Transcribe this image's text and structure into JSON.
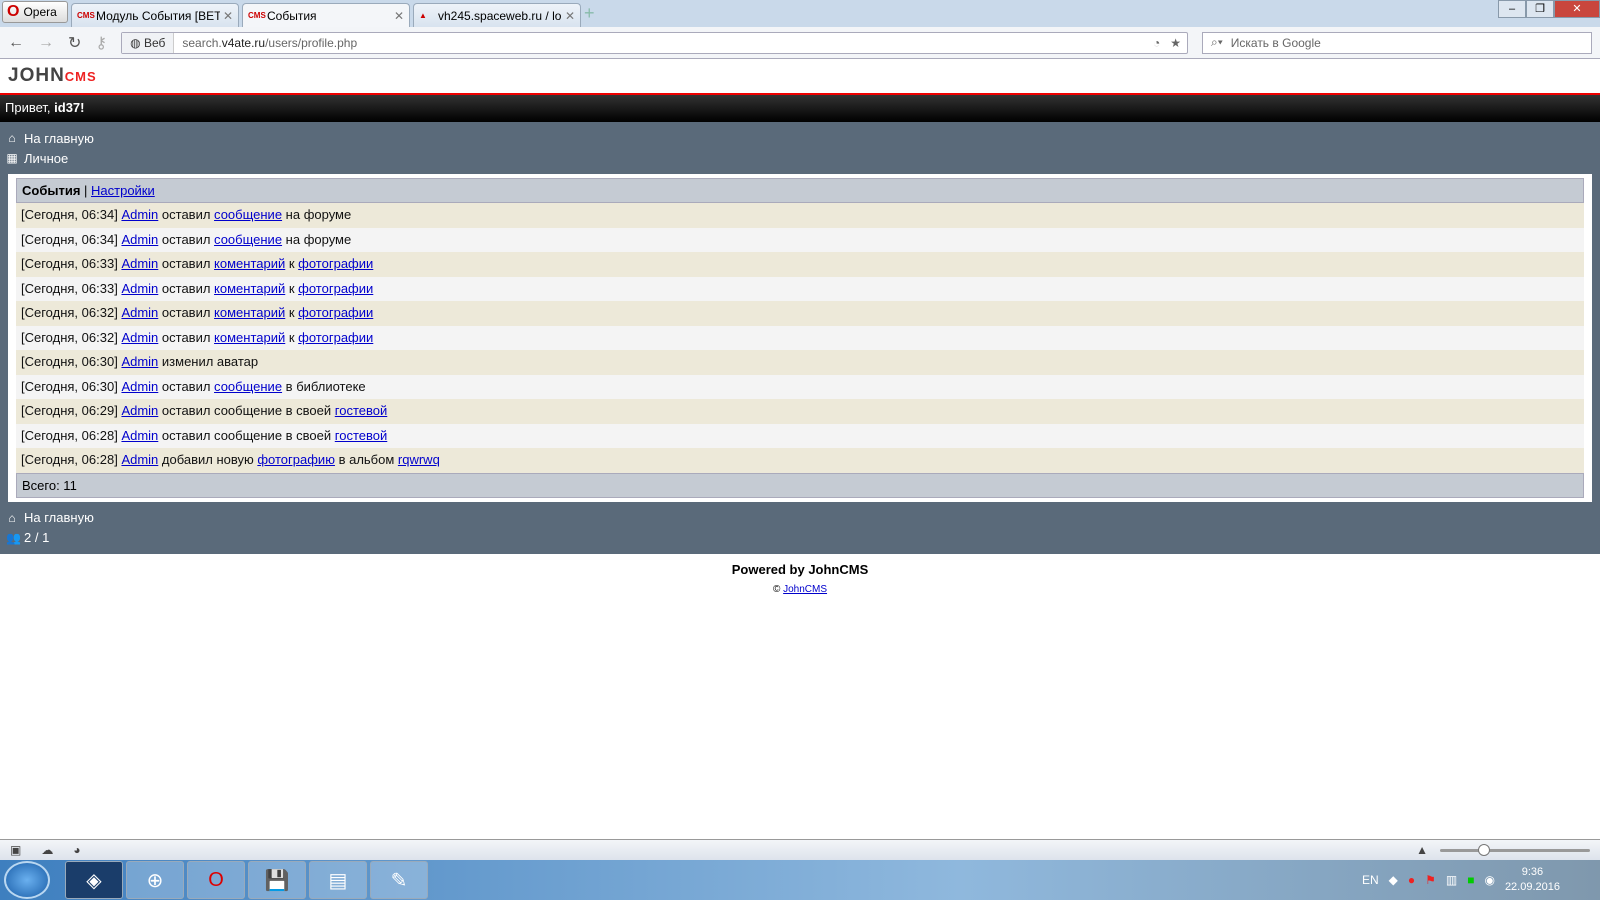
{
  "browser": {
    "menu_label": "Opera",
    "tabs": [
      {
        "title": "Модуль События [BET...",
        "icon": "cms-icon"
      },
      {
        "title": "События",
        "icon": "cms-icon",
        "active": true
      },
      {
        "title": "vh245.spaceweb.ru / lo...",
        "icon": "pma-icon"
      }
    ],
    "web_label": "Веб",
    "url_host": "search.",
    "url_domain": "v4ate.ru",
    "url_path": "/users/profile.php",
    "search_placeholder": "Искать в Google"
  },
  "site": {
    "logo_main": "JOHN",
    "logo_sub": "CMS",
    "greeting": "Привет, ",
    "username": "id37!",
    "nav_top": [
      {
        "label": "На главную",
        "icon": "home-icon"
      },
      {
        "label": "Личное",
        "icon": "grid-icon"
      }
    ],
    "panel_title": "События",
    "panel_sep": " | ",
    "panel_settings": "Настройки",
    "events": [
      {
        "time": "[Сегодня, 06:34]",
        "user": "Admin",
        "parts": [
          " оставил ",
          {
            "link": "сообщение"
          },
          " на форуме"
        ]
      },
      {
        "time": "[Сегодня, 06:34]",
        "user": "Admin",
        "parts": [
          " оставил ",
          {
            "link": "сообщение"
          },
          " на форуме"
        ]
      },
      {
        "time": "[Сегодня, 06:33]",
        "user": "Admin",
        "parts": [
          " оставил ",
          {
            "link": "коментарий"
          },
          " к ",
          {
            "link": "фотографии"
          }
        ]
      },
      {
        "time": "[Сегодня, 06:33]",
        "user": "Admin",
        "parts": [
          " оставил ",
          {
            "link": "коментарий"
          },
          " к ",
          {
            "link": "фотографии"
          }
        ]
      },
      {
        "time": "[Сегодня, 06:32]",
        "user": "Admin",
        "parts": [
          " оставил ",
          {
            "link": "коментарий"
          },
          " к ",
          {
            "link": "фотографии"
          }
        ]
      },
      {
        "time": "[Сегодня, 06:32]",
        "user": "Admin",
        "parts": [
          " оставил ",
          {
            "link": "коментарий"
          },
          " к ",
          {
            "link": "фотографии"
          }
        ]
      },
      {
        "time": "[Сегодня, 06:30]",
        "user": "Admin",
        "parts": [
          " изменил аватар"
        ]
      },
      {
        "time": "[Сегодня, 06:30]",
        "user": "Admin",
        "parts": [
          " оставил ",
          {
            "link": "сообщение"
          },
          " в библиотеке"
        ]
      },
      {
        "time": "[Сегодня, 06:29]",
        "user": "Admin",
        "parts": [
          " оставил сообщение в своей ",
          {
            "link": "гостевой"
          }
        ]
      },
      {
        "time": "[Сегодня, 06:28]",
        "user": "Admin",
        "parts": [
          " оставил сообщение в своей ",
          {
            "link": "гостевой"
          }
        ]
      },
      {
        "time": "[Сегодня, 06:28]",
        "user": "Admin",
        "parts": [
          " добавил новую ",
          {
            "link": "фотографию"
          },
          " в альбом ",
          {
            "link": "rqwrwq"
          }
        ]
      }
    ],
    "total": "Всего: 11",
    "nav_bottom": [
      {
        "label": "На главную",
        "icon": "home-icon"
      },
      {
        "label": "2 / 1",
        "icon": "users-icon"
      }
    ],
    "powered": "Powered by JohnCMS",
    "copyright_symbol": "© ",
    "copyright_link": "JohnCMS"
  },
  "taskbar": {
    "lang": "EN",
    "time": "9:36",
    "date": "22.09.2016"
  }
}
